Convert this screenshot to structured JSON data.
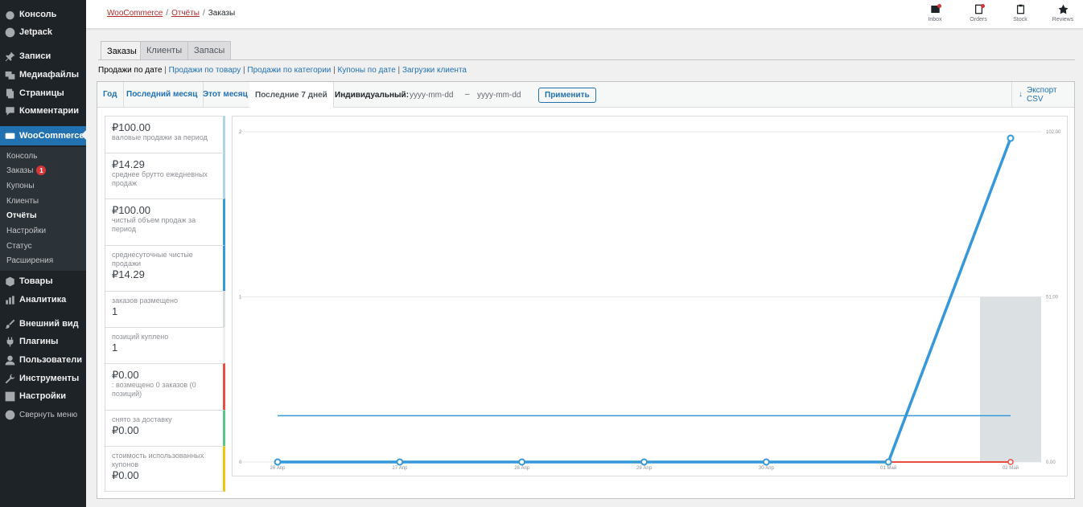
{
  "sidebar": {
    "items": [
      {
        "label": "Консоль",
        "icon": "dashboard-icon"
      },
      {
        "label": "Jetpack",
        "icon": "jetpack-icon"
      },
      {
        "label": "Записи",
        "icon": "pin-icon"
      },
      {
        "label": "Медиафайлы",
        "icon": "media-icon"
      },
      {
        "label": "Страницы",
        "icon": "pages-icon"
      },
      {
        "label": "Комментарии",
        "icon": "comment-icon"
      },
      {
        "label": "WooCommerce",
        "icon": "woo-icon"
      },
      {
        "label": "Товары",
        "icon": "box-icon"
      },
      {
        "label": "Аналитика",
        "icon": "analytics-icon"
      },
      {
        "label": "Внешний вид",
        "icon": "brush-icon"
      },
      {
        "label": "Плагины",
        "icon": "plugin-icon"
      },
      {
        "label": "Пользователи",
        "icon": "user-icon"
      },
      {
        "label": "Инструменты",
        "icon": "wrench-icon"
      },
      {
        "label": "Настройки",
        "icon": "settings-icon"
      },
      {
        "label": "Свернуть меню",
        "icon": "collapse-icon"
      }
    ],
    "submenu": [
      {
        "label": "Консоль"
      },
      {
        "label": "Заказы",
        "badge": "1"
      },
      {
        "label": "Купоны"
      },
      {
        "label": "Клиенты"
      },
      {
        "label": "Отчёты"
      },
      {
        "label": "Настройки"
      },
      {
        "label": "Статус"
      },
      {
        "label": "Расширения"
      }
    ]
  },
  "breadcrumb": {
    "root": "WooCommerce",
    "parent": "Отчёты",
    "current": "Заказы"
  },
  "toolbar": {
    "inbox": "Inbox",
    "orders": "Orders",
    "stock": "Stock",
    "reviews": "Reviews"
  },
  "tabs": [
    "Заказы",
    "Клиенты",
    "Запасы"
  ],
  "sublinks": {
    "current": "Продажи по дате",
    "links": [
      "Продажи по товару",
      "Продажи по категории",
      "Купоны по дате",
      "Загрузки клиента"
    ]
  },
  "ranges": [
    "Год",
    "Последний месяц",
    "Этот месяц",
    "Последние 7 дней"
  ],
  "custom": {
    "label": "Индивидуальный:",
    "start_placeholder": "yyyy-mm-dd",
    "end_placeholder": "yyyy-mm-dd",
    "separator": "–",
    "apply": "Применить"
  },
  "export": "Экспорт CSV",
  "legend": [
    {
      "amount": "₽100.00",
      "label": "валовые продажи за период",
      "color": "#b1d4ea",
      "amount_first": true
    },
    {
      "amount": "₽14.29",
      "label": "среднее брутто ежедневных продаж",
      "color": "#b1d4ea",
      "amount_first": true
    },
    {
      "amount": "₽100.00",
      "label": "чистый объем продаж за период",
      "color": "#3498db",
      "amount_first": true
    },
    {
      "amount": "₽14.29",
      "label": "среднесуточные чистые продажи",
      "color": "#3498db",
      "amount_first": false
    },
    {
      "amount": "1",
      "label": "заказов размещено",
      "color": "#dbe1e3",
      "amount_first": false
    },
    {
      "amount": "1",
      "label": "позиций куплено",
      "color": "#ecf0f1",
      "amount_first": false
    },
    {
      "amount": "₽0.00",
      "label": ": возмещено 0 заказов (0 позиций)",
      "color": "#e74c3c",
      "amount_first": true
    },
    {
      "amount": "₽0.00",
      "label": "снято за доставку",
      "color": "#5cc488",
      "amount_first": false
    },
    {
      "amount": "₽0.00",
      "label": "стоимость использованных купонов",
      "color": "#f1c40f",
      "amount_first": false
    }
  ],
  "chart_data": {
    "type": "line",
    "categories": [
      "26 Апр",
      "27 Апр",
      "28 Апр",
      "29 Апр",
      "30 Апр",
      "01 Май",
      "02 Май"
    ],
    "left_ticks": [
      "0",
      "1",
      "2"
    ],
    "right_ticks": [
      "0.00",
      "51.00",
      "102.00"
    ],
    "ylim_left": [
      0,
      2
    ],
    "ylim_right": [
      0,
      102
    ],
    "series": [
      {
        "values": [
          0,
          0,
          0,
          0,
          0,
          0,
          1
        ],
        "type": "bar",
        "axis": "left",
        "color": "#dbe1e3"
      },
      {
        "values": [
          0,
          0,
          0,
          0,
          0,
          0,
          100
        ],
        "type": "line",
        "axis": "right",
        "color": "#3498db"
      },
      {
        "values": [
          14.29,
          14.29,
          14.29,
          14.29,
          14.29,
          14.29,
          14.29
        ],
        "type": "line",
        "axis": "right",
        "color": "#3498db"
      },
      {
        "values": [
          0,
          0,
          0,
          0,
          0,
          0,
          0
        ],
        "type": "line",
        "axis": "right",
        "color": "#e74c3c"
      },
      {
        "values": [
          0,
          0,
          0,
          0,
          0,
          0,
          0
        ],
        "type": "line",
        "axis": "right",
        "color": "#8e5ea2"
      }
    ]
  }
}
